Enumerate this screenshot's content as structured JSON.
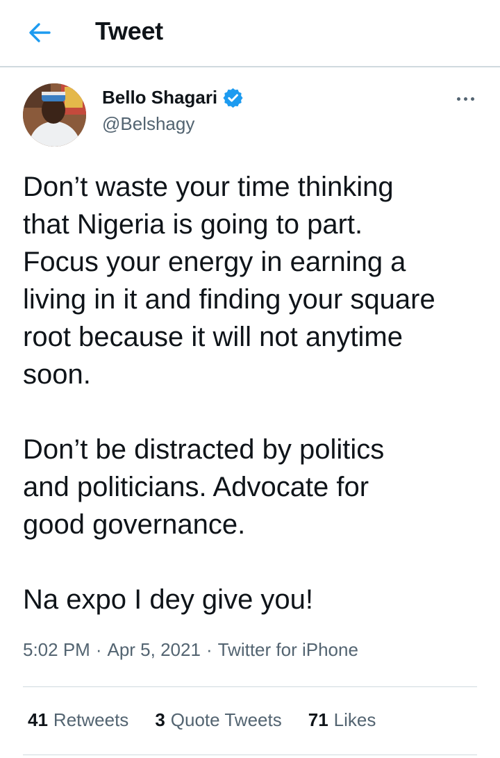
{
  "header": {
    "title": "Tweet",
    "back_icon": "arrow-left-icon"
  },
  "colors": {
    "accent": "#1d9bf0",
    "secondary_text": "#536471",
    "divider": "#cfd9de"
  },
  "author": {
    "display_name": "Bello Shagari",
    "handle": "@Belshagy",
    "verified": true,
    "verified_icon": "verified-badge-icon"
  },
  "more_icon": "more-horizontal-icon",
  "tweet": {
    "paragraphs": [
      "Don’t waste your time thinking\nthat Nigeria is going to part.\nFocus your energy in earning a\nliving in it and finding your square\nroot because it will not anytime\nsoon.",
      "Don’t be distracted by politics\nand politicians. Advocate for\ngood governance.",
      "Na expo I dey give you!"
    ],
    "time": "5:02 PM",
    "date": "Apr 5, 2021",
    "source": "Twitter for iPhone"
  },
  "stats": {
    "retweets_count": "41",
    "retweets_label": "Retweets",
    "quotes_count": "3",
    "quotes_label": "Quote Tweets",
    "likes_count": "71",
    "likes_label": "Likes"
  }
}
